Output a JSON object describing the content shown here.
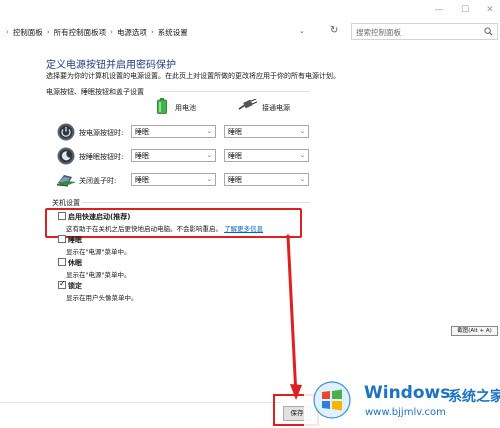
{
  "window": {
    "minimize": "—",
    "maximize": "☐",
    "close": "✕"
  },
  "breadcrumb": [
    "控制面板",
    "所有控制面板项",
    "电源选项",
    "系统设置"
  ],
  "address": {
    "dropdown": "⌄",
    "refresh": "↻"
  },
  "search": {
    "placeholder": "搜索控制面板"
  },
  "page": {
    "title": "定义电源按钮并启用密码保护",
    "subtitle": "选择要为你的计算机设置的电源设置。在此页上对设置所做的更改将应用于你的所有电源计划。",
    "group_label": "电源按钮、睡眠按钮和盖子设置",
    "col_battery": "用电池",
    "col_plugged": "接通电源"
  },
  "rows": [
    {
      "label": "按电源按钮时:",
      "battery": "睡眠",
      "plugged": "睡眠"
    },
    {
      "label": "按睡眠按钮时:",
      "battery": "睡眠",
      "plugged": "睡眠"
    },
    {
      "label": "关闭盖子时:",
      "battery": "睡眠",
      "plugged": "睡眠"
    }
  ],
  "shutdown": {
    "label": "关机设置",
    "options": [
      {
        "title": "启用快速启动(推荐)",
        "desc": "这有助于在关机之后更快地启动电脑。不会影响重启。",
        "link": "了解更多信息",
        "checked": false
      },
      {
        "title": "睡眠",
        "desc": "显示在\"电源\"菜单中。",
        "checked": false
      },
      {
        "title": "休眠",
        "desc": "显示在\"电源\"菜单中。",
        "checked": false
      },
      {
        "title": "锁定",
        "desc": "显示在用户头像菜单中。",
        "checked": true
      }
    ]
  },
  "tooltip": "截图(Alt + A)",
  "save_button": "保存",
  "watermark": {
    "brand": "Windows",
    "cn": "系统之家",
    "url": "www.bjjmlv.com"
  },
  "colors": {
    "heading": "#1e3a8a",
    "link": "#0066cc",
    "annotation": "#e02020",
    "watermark": "#1a73c9"
  }
}
